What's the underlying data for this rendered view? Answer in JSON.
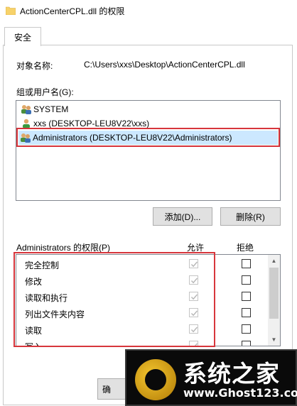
{
  "window": {
    "title": "ActionCenterCPL.dll 的权限"
  },
  "tabs": [
    {
      "label": "安全"
    }
  ],
  "object": {
    "label": "对象名称:",
    "value": "C:\\Users\\xxs\\Desktop\\ActionCenterCPL.dll"
  },
  "groups": {
    "label": "组或用户名(G):",
    "items": [
      {
        "name": "SYSTEM"
      },
      {
        "name": "xxs (DESKTOP-LEU8V22\\xxs)"
      },
      {
        "name": "Administrators (DESKTOP-LEU8V22\\Administrators)",
        "selected": true
      }
    ]
  },
  "buttons": {
    "add": "添加(D)...",
    "remove": "删除(R)",
    "ok": "确"
  },
  "permissions": {
    "label": "Administrators 的权限(P)",
    "allow_header": "允许",
    "deny_header": "拒绝",
    "items": [
      {
        "name": "完全控制",
        "allow": true,
        "deny": false
      },
      {
        "name": "修改",
        "allow": true,
        "deny": false
      },
      {
        "name": "读取和执行",
        "allow": true,
        "deny": false
      },
      {
        "name": "列出文件夹内容",
        "allow": true,
        "deny": false
      },
      {
        "name": "读取",
        "allow": true,
        "deny": false
      },
      {
        "name": "写入",
        "allow": true,
        "deny": false
      }
    ]
  },
  "watermark": {
    "title": "系统之家",
    "url": "www.Ghost123.com"
  },
  "colors": {
    "highlight_box": "#d7363c",
    "selection": "#cce8ff"
  }
}
